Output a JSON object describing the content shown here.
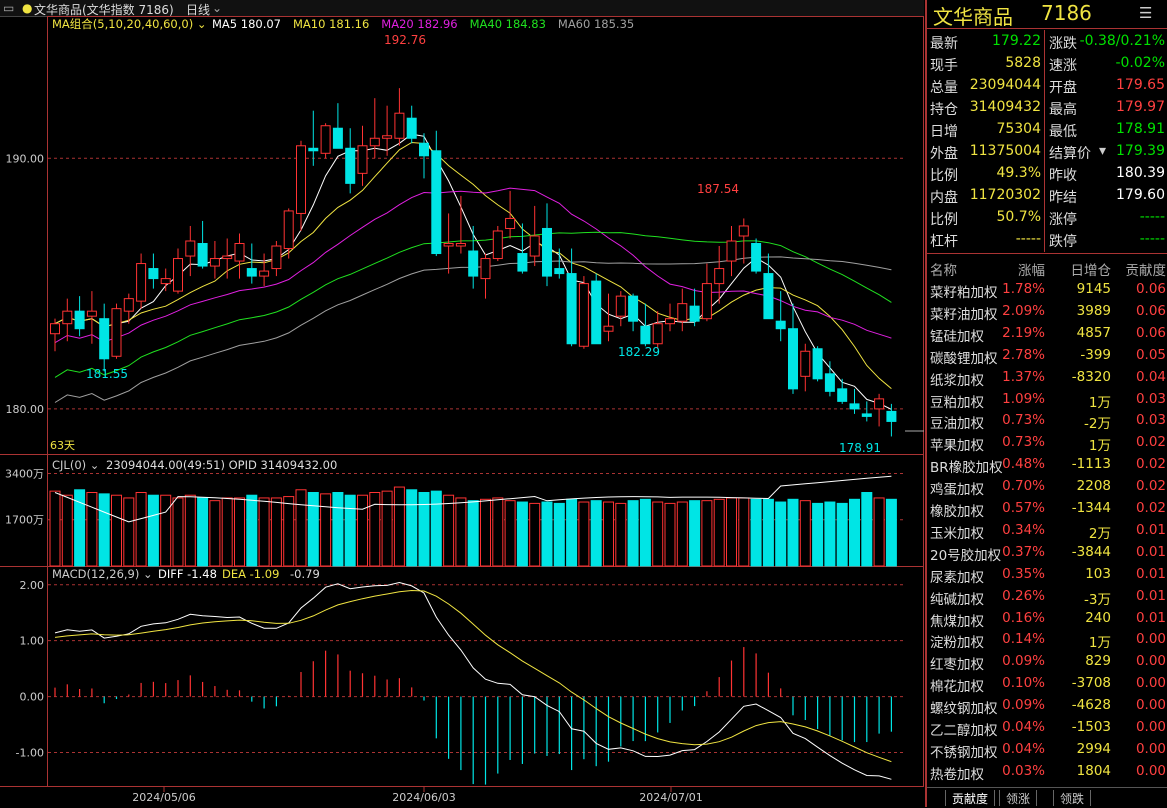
{
  "window": {
    "title": "文华商品(文华指数 7186)",
    "period": "日线"
  },
  "legend": {
    "ma_group": "MA组合(5,10,20,40,60,0)",
    "items": [
      {
        "label": "MA5 180.07",
        "color": "#ffffff"
      },
      {
        "label": "MA10 181.16",
        "color": "#f0e442"
      },
      {
        "label": "MA20 182.96",
        "color": "#e020e0"
      },
      {
        "label": "MA40 184.83",
        "color": "#20e020"
      },
      {
        "label": "MA60 185.35",
        "color": "#a0a0a0"
      }
    ]
  },
  "volume_legend": "CJL(0)",
  "volume_values": "23094044.00(49:51)  OPID 31409432.00",
  "macd_legend": "MACD(12,26,9)",
  "macd_values": {
    "diff": "DIFF -1.48",
    "dea": "DEA -1.09",
    "macd": "-0.79"
  },
  "price_axis": [
    "190.00",
    "180.00"
  ],
  "volume_axis": [
    "3400万",
    "1700万"
  ],
  "macd_axis": [
    "2.00",
    "1.00",
    "0.00",
    "-1.00"
  ],
  "date_axis": [
    "2024/05/06",
    "2024/06/03",
    "2024/07/01"
  ],
  "annotations": {
    "high1": "192.76",
    "high2": "187.54",
    "low1": "181.55",
    "low2": "182.29",
    "low3": "178.91",
    "days": "63天"
  },
  "colors": {
    "up": "#ff3333",
    "down": "#00e5e5",
    "accent": "#ff4040"
  },
  "chart_data": {
    "type": "candlestick",
    "x_dates": [
      "2024/05/06",
      "2024/06/03",
      "2024/07/01"
    ],
    "price_ylim": [
      178.2,
      195.2
    ],
    "candles": [
      [
        183.0,
        183.6,
        182.3,
        183.4
      ],
      [
        183.4,
        184.4,
        182.7,
        183.9
      ],
      [
        183.9,
        184.5,
        182.9,
        183.2
      ],
      [
        183.7,
        184.7,
        182.6,
        183.9
      ],
      [
        183.6,
        184.2,
        181.5,
        182.0
      ],
      [
        182.1,
        184.2,
        182.0,
        184.0
      ],
      [
        183.9,
        184.6,
        183.4,
        184.4
      ],
      [
        184.3,
        186.2,
        184.0,
        185.8
      ],
      [
        185.6,
        186.2,
        184.8,
        185.2
      ],
      [
        185.0,
        185.6,
        184.7,
        185.2
      ],
      [
        184.7,
        186.4,
        184.6,
        186.0
      ],
      [
        186.1,
        187.3,
        185.3,
        186.7
      ],
      [
        186.6,
        187.5,
        185.6,
        185.7
      ],
      [
        185.7,
        186.7,
        185.2,
        186.0
      ],
      [
        186.0,
        186.8,
        185.2,
        186.1
      ],
      [
        185.9,
        187.0,
        185.2,
        186.6
      ],
      [
        185.6,
        186.6,
        185.0,
        185.3
      ],
      [
        185.3,
        186.2,
        184.9,
        185.5
      ],
      [
        185.6,
        186.7,
        185.3,
        186.5
      ],
      [
        186.4,
        188.0,
        186.0,
        187.9
      ],
      [
        187.8,
        190.7,
        187.1,
        190.5
      ],
      [
        190.4,
        191.9,
        189.7,
        190.3
      ],
      [
        190.2,
        191.4,
        190.0,
        191.3
      ],
      [
        191.2,
        192.2,
        190.4,
        190.4
      ],
      [
        190.4,
        191.2,
        188.6,
        189.0
      ],
      [
        189.4,
        191.3,
        188.9,
        190.5
      ],
      [
        190.5,
        192.4,
        190.0,
        190.8
      ],
      [
        190.8,
        192.1,
        190.1,
        190.9
      ],
      [
        190.8,
        192.8,
        190.5,
        191.8
      ],
      [
        191.6,
        192.1,
        190.6,
        190.8
      ],
      [
        190.6,
        191.0,
        189.2,
        190.1
      ],
      [
        190.3,
        191.1,
        186.1,
        186.2
      ],
      [
        186.5,
        187.8,
        185.4,
        186.6
      ],
      [
        186.5,
        188.5,
        186.2,
        186.6
      ],
      [
        186.3,
        187.3,
        184.8,
        185.3
      ],
      [
        185.2,
        186.2,
        184.4,
        186.0
      ],
      [
        186.0,
        187.3,
        185.9,
        187.1
      ],
      [
        187.2,
        188.7,
        186.8,
        187.6
      ],
      [
        186.2,
        187.4,
        185.4,
        185.5
      ],
      [
        186.1,
        188.1,
        185.7,
        186.9
      ],
      [
        187.2,
        188.2,
        184.9,
        185.3
      ],
      [
        185.6,
        186.4,
        185.2,
        185.4
      ],
      [
        185.4,
        186.4,
        182.5,
        182.6
      ],
      [
        182.5,
        185.3,
        182.4,
        185.0
      ],
      [
        185.1,
        185.4,
        182.6,
        182.6
      ],
      [
        183.1,
        184.6,
        182.7,
        183.3
      ],
      [
        183.7,
        184.7,
        183.3,
        184.5
      ],
      [
        184.5,
        184.6,
        183.1,
        183.5
      ],
      [
        183.3,
        184.2,
        182.5,
        182.6
      ],
      [
        182.6,
        183.9,
        182.4,
        183.4
      ],
      [
        183.4,
        184.2,
        183.1,
        183.6
      ],
      [
        183.5,
        184.8,
        183.1,
        184.2
      ],
      [
        184.1,
        184.8,
        183.3,
        183.5
      ],
      [
        183.6,
        185.8,
        183.5,
        185.0
      ],
      [
        185.0,
        186.5,
        184.2,
        185.6
      ],
      [
        185.9,
        187.3,
        185.3,
        186.7
      ],
      [
        186.9,
        187.6,
        185.8,
        187.3
      ],
      [
        186.6,
        186.8,
        185.4,
        185.5
      ],
      [
        185.4,
        186.2,
        183.6,
        183.6
      ],
      [
        183.5,
        184.7,
        182.7,
        183.2
      ],
      [
        183.2,
        184.2,
        180.6,
        180.8
      ],
      [
        181.3,
        182.6,
        180.7,
        182.3
      ],
      [
        182.4,
        182.5,
        181.1,
        181.2
      ],
      [
        181.4,
        181.9,
        180.5,
        180.7
      ],
      [
        180.8,
        181.2,
        180.2,
        180.3
      ],
      [
        180.2,
        180.8,
        179.8,
        180.0
      ],
      [
        179.8,
        180.3,
        179.5,
        179.7
      ],
      [
        180.0,
        180.6,
        179.3,
        180.4
      ],
      [
        179.9,
        180.2,
        178.9,
        179.5
      ]
    ],
    "volume_ylim": [
      0,
      3600
    ],
    "volume_unit": "万",
    "macd_ylim": [
      -1.6,
      2.3
    ]
  },
  "quote": {
    "name": "文华商品",
    "code": "7186",
    "menu_icon": "list-icon",
    "rows": [
      {
        "l1": "最新",
        "v1": "179.22",
        "c1": "#00e000",
        "l2": "涨跌",
        "v2": "-0.38/0.21%",
        "c2": "#00e000"
      },
      {
        "l1": "现手",
        "v1": "5828",
        "c1": "#f0e442",
        "l2": "速涨",
        "v2": "-0.02%",
        "c2": "#00e000"
      },
      {
        "l1": "总量",
        "v1": "23094044",
        "c1": "#f0e442",
        "l2": "开盘",
        "v2": "179.65",
        "c2": "#ff4040"
      },
      {
        "l1": "持仓",
        "v1": "31409432",
        "c1": "#f0e442",
        "l2": "最高",
        "v2": "179.97",
        "c2": "#ff4040"
      },
      {
        "l1": "日增",
        "v1": "75304",
        "c1": "#f0e442",
        "l2": "最低",
        "v2": "178.91",
        "c2": "#00e000"
      },
      {
        "l1": "外盘",
        "v1": "11375004",
        "c1": "#f0e442",
        "l2": "结算价",
        "v2": "179.39",
        "c2": "#00e000"
      },
      {
        "l1": "比例",
        "v1": "49.3%",
        "c1": "#f0e442",
        "l2": "昨收",
        "v2": "180.39",
        "c2": "#ffffff"
      },
      {
        "l1": "内盘",
        "v1": "11720302",
        "c1": "#f0e442",
        "l2": "昨结",
        "v2": "179.60",
        "c2": "#ffffff"
      },
      {
        "l1": "比例",
        "v1": "50.7%",
        "c1": "#f0e442",
        "l2": "涨停",
        "v2": "-----",
        "c2": "#00e000"
      },
      {
        "l1": "杠杆",
        "v1": "-----",
        "c1": "#f0e442",
        "l2": "跌停",
        "v2": "-----",
        "c2": "#00e000"
      }
    ]
  },
  "table": {
    "headers": [
      "名称",
      "涨幅",
      "日增仓",
      "贡献度"
    ],
    "rows": [
      [
        "菜籽粕加权",
        "1.78%",
        "9145",
        "0.06"
      ],
      [
        "菜籽油加权",
        "2.09%",
        "3989",
        "0.06"
      ],
      [
        "锰硅加权",
        "2.19%",
        "4857",
        "0.06"
      ],
      [
        "碳酸锂加权",
        "2.78%",
        "-399",
        "0.05"
      ],
      [
        "纸浆加权",
        "1.37%",
        "-8320",
        "0.04"
      ],
      [
        "豆粕加权",
        "1.09%",
        "1万",
        "0.03"
      ],
      [
        "豆油加权",
        "0.73%",
        "-2万",
        "0.03"
      ],
      [
        "苹果加权",
        "0.73%",
        "1万",
        "0.02"
      ],
      [
        "BR橡胶加权",
        "0.48%",
        "-1113",
        "0.02"
      ],
      [
        "鸡蛋加权",
        "0.70%",
        "2208",
        "0.02"
      ],
      [
        "橡胶加权",
        "0.57%",
        "-1344",
        "0.02"
      ],
      [
        "玉米加权",
        "0.34%",
        "2万",
        "0.01"
      ],
      [
        "20号胶加权",
        "0.37%",
        "-3844",
        "0.01"
      ],
      [
        "尿素加权",
        "0.35%",
        "103",
        "0.01"
      ],
      [
        "纯碱加权",
        "0.26%",
        "-3万",
        "0.01"
      ],
      [
        "焦煤加权",
        "0.16%",
        "240",
        "0.01"
      ],
      [
        "淀粉加权",
        "0.14%",
        "1万",
        "0.00"
      ],
      [
        "红枣加权",
        "0.09%",
        "829",
        "0.00"
      ],
      [
        "棉花加权",
        "0.10%",
        "-3708",
        "0.00"
      ],
      [
        "螺纹钢加权",
        "0.09%",
        "-4628",
        "0.00"
      ],
      [
        "乙二醇加权",
        "0.04%",
        "-1503",
        "0.00"
      ],
      [
        "不锈钢加权",
        "0.04%",
        "2994",
        "0.00"
      ],
      [
        "热卷加权",
        "0.03%",
        "1804",
        "0.00"
      ]
    ]
  },
  "tabs": [
    "贡献度",
    "领涨",
    "领跌"
  ]
}
